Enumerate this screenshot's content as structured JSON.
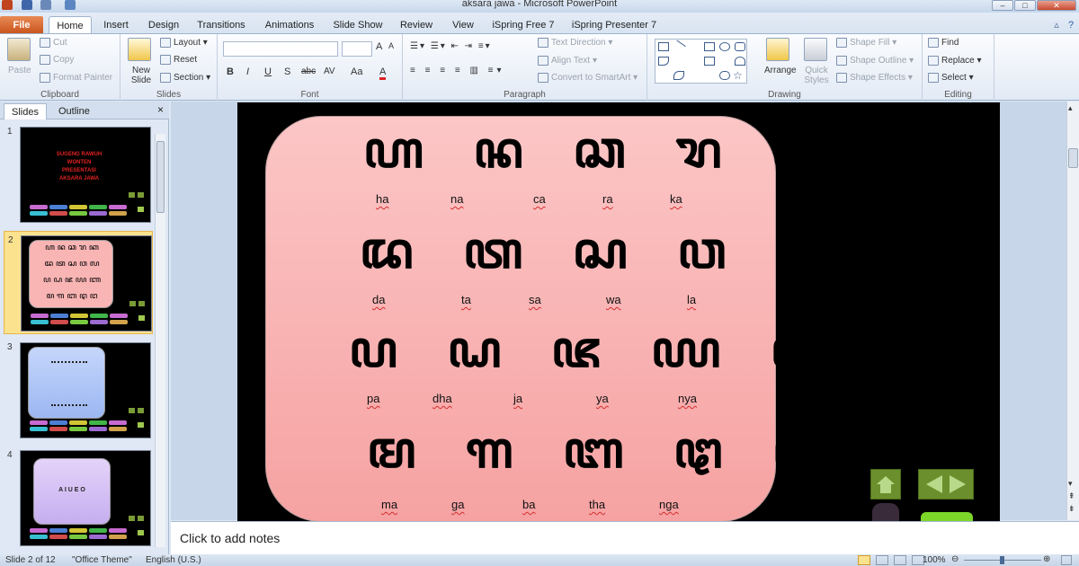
{
  "window": {
    "title": "aksara jawa - Microsoft PowerPoint"
  },
  "tabs": [
    "File",
    "Home",
    "Insert",
    "Design",
    "Transitions",
    "Animations",
    "Slide Show",
    "Review",
    "View",
    "iSpring Free 7",
    "iSpring Presenter 7"
  ],
  "ribbon": {
    "clipboard": {
      "label": "Clipboard",
      "paste": "Paste",
      "cut": "Cut",
      "copy": "Copy",
      "format_painter": "Format Painter"
    },
    "slides": {
      "label": "Slides",
      "new_slide": "New Slide",
      "layout": "Layout",
      "reset": "Reset",
      "section": "Section"
    },
    "font": {
      "label": "Font",
      "bold": "B",
      "italic": "I",
      "underline": "U",
      "shadow": "S",
      "strike": "abc",
      "spacing": "AV",
      "case": "Aa",
      "color": "A"
    },
    "paragraph": {
      "label": "Paragraph",
      "text_direction": "Text Direction",
      "align_text": "Align Text",
      "smartart": "Convert to SmartArt"
    },
    "drawing": {
      "label": "Drawing",
      "arrange": "Arrange",
      "quick_styles": "Quick Styles",
      "shape_fill": "Shape Fill",
      "shape_outline": "Shape Outline",
      "shape_effects": "Shape Effects"
    },
    "editing": {
      "label": "Editing",
      "find": "Find",
      "replace": "Replace",
      "select": "Select"
    }
  },
  "pane": {
    "tab_slides": "Slides",
    "tab_outline": "Outline",
    "close": "×",
    "numbers": [
      "1",
      "2",
      "3",
      "4"
    ],
    "slide1_text": [
      "SUGENG RAWUH",
      "WONTEN",
      "PRESENTASI",
      "AKSARA JAWA"
    ],
    "slide4_text": "A  I  U  E  O"
  },
  "slide": {
    "jawa_rows": [
      "ꦲ ꦤ ꦕ ꦫ ꦏ",
      "ꦢ ꦠ ꦱ ꦮ ꦭ",
      "ꦥ ꦝ ꦗ ꦪ ꦚ",
      "ꦩ ꦒ ꦧ ꦛ ꦔ"
    ],
    "latin_rows": [
      [
        "ha",
        "na",
        "ca",
        "ra",
        "ka"
      ],
      [
        "da",
        "ta",
        "sa",
        "wa",
        "la"
      ],
      [
        "pa",
        "dha",
        "ja",
        "ya",
        "nya"
      ],
      [
        "ma",
        "ga",
        "ba",
        "tha",
        "nga"
      ]
    ]
  },
  "notes": {
    "placeholder": "Click to add notes"
  },
  "status": {
    "slide": "Slide 2 of 12",
    "theme": "\"Office Theme\"",
    "language": "English (U.S.)",
    "zoom": "100%"
  }
}
